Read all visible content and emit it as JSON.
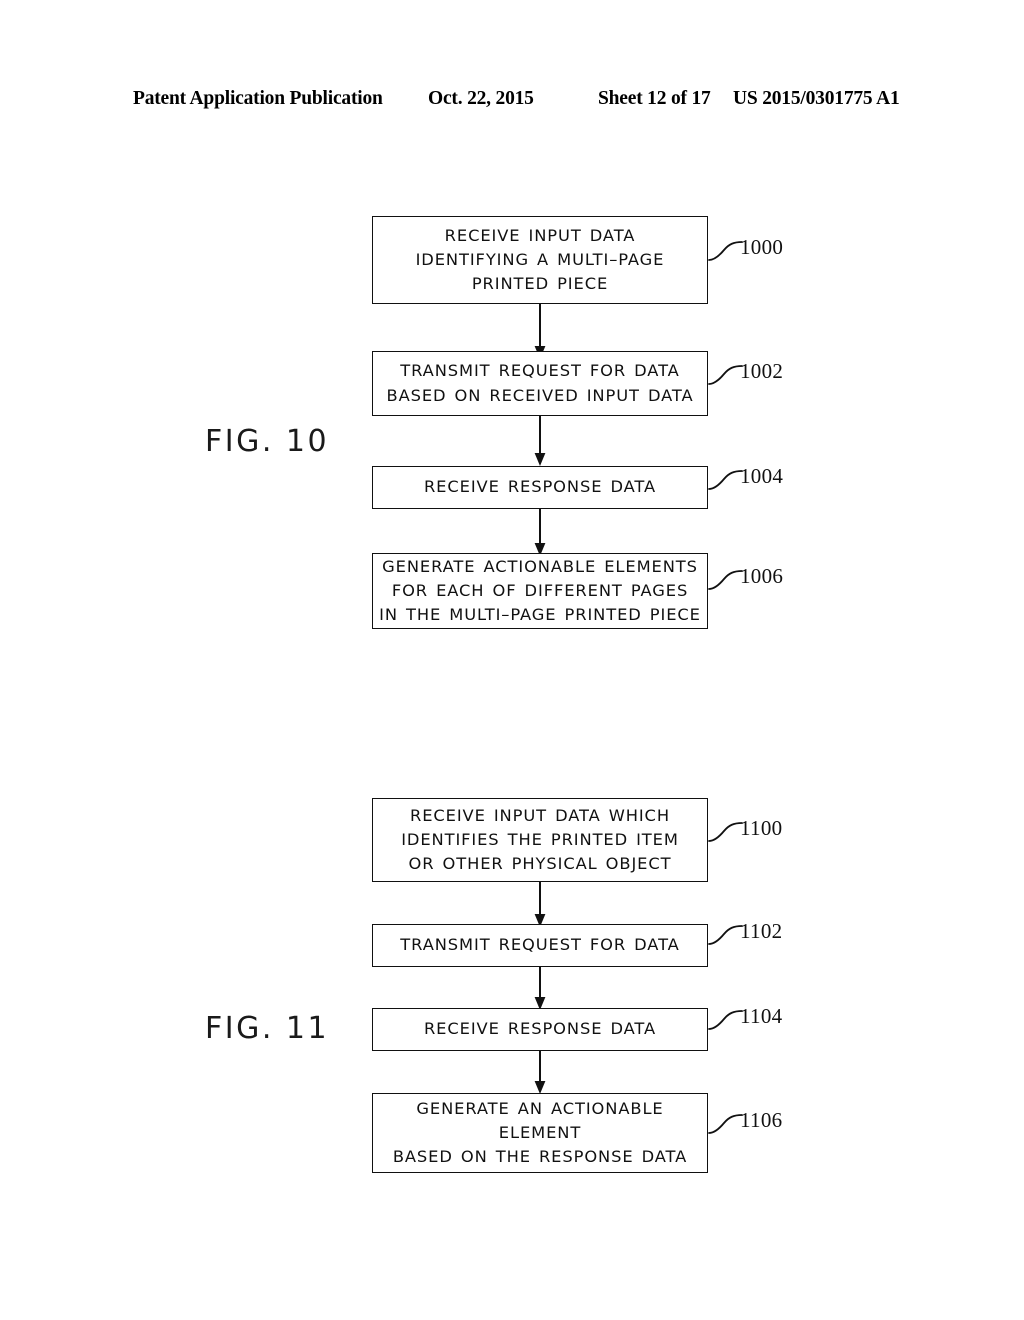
{
  "header": {
    "publication": "Patent Application Publication",
    "date": "Oct. 22, 2015",
    "sheet": "Sheet 12 of 17",
    "patent_number": "US 2015/0301775 A1"
  },
  "figures": [
    {
      "label": "FIG. 10",
      "steps": [
        {
          "ref": "1000",
          "text": "RECEIVE  INPUT  DATA\nIDENTIFYING  A  MULTI–PAGE\nPRINTED  PIECE"
        },
        {
          "ref": "1002",
          "text": "TRANSMIT  REQUEST  FOR  DATA\nBASED  ON  RECEIVED  INPUT  DATA"
        },
        {
          "ref": "1004",
          "text": "RECEIVE  RESPONSE  DATA"
        },
        {
          "ref": "1006",
          "text": "GENERATE  ACTIONABLE  ELEMENTS\nFOR  EACH  OF  DIFFERENT  PAGES\nIN  THE  MULTI–PAGE  PRINTED  PIECE"
        }
      ]
    },
    {
      "label": "FIG. 11",
      "steps": [
        {
          "ref": "1100",
          "text": "RECEIVE  INPUT  DATA  WHICH\nIDENTIFIES  THE  PRINTED  ITEM\nOR  OTHER  PHYSICAL  OBJECT"
        },
        {
          "ref": "1102",
          "text": "TRANSMIT  REQUEST  FOR  DATA"
        },
        {
          "ref": "1104",
          "text": "RECEIVE  RESPONSE  DATA"
        },
        {
          "ref": "1106",
          "text": "GENERATE  AN  ACTIONABLE  ELEMENT\nBASED  ON  THE  RESPONSE  DATA"
        }
      ]
    }
  ],
  "colors": {
    "ink": "#111111",
    "paper": "#ffffff"
  }
}
